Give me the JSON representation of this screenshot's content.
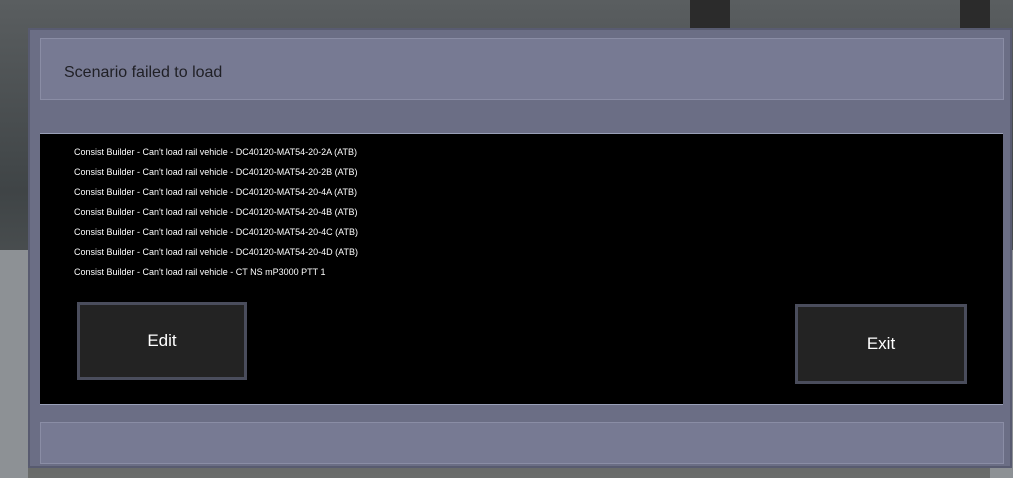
{
  "dialog": {
    "title": "Scenario failed to load",
    "messages": [
      "Consist Builder - Can't load rail vehicle - DC40120-MAT54-20-2A (ATB)",
      "Consist Builder - Can't load rail vehicle - DC40120-MAT54-20-2B (ATB)",
      "Consist Builder - Can't load rail vehicle - DC40120-MAT54-20-4A (ATB)",
      "Consist Builder - Can't load rail vehicle - DC40120-MAT54-20-4B (ATB)",
      "Consist Builder - Can't load rail vehicle - DC40120-MAT54-20-4C (ATB)",
      "Consist Builder - Can't load rail vehicle - DC40120-MAT54-20-4D (ATB)",
      "Consist Builder - Can't load rail vehicle - CT NS mP3000 PTT 1"
    ],
    "edit_label": "Edit",
    "exit_label": "Exit"
  }
}
